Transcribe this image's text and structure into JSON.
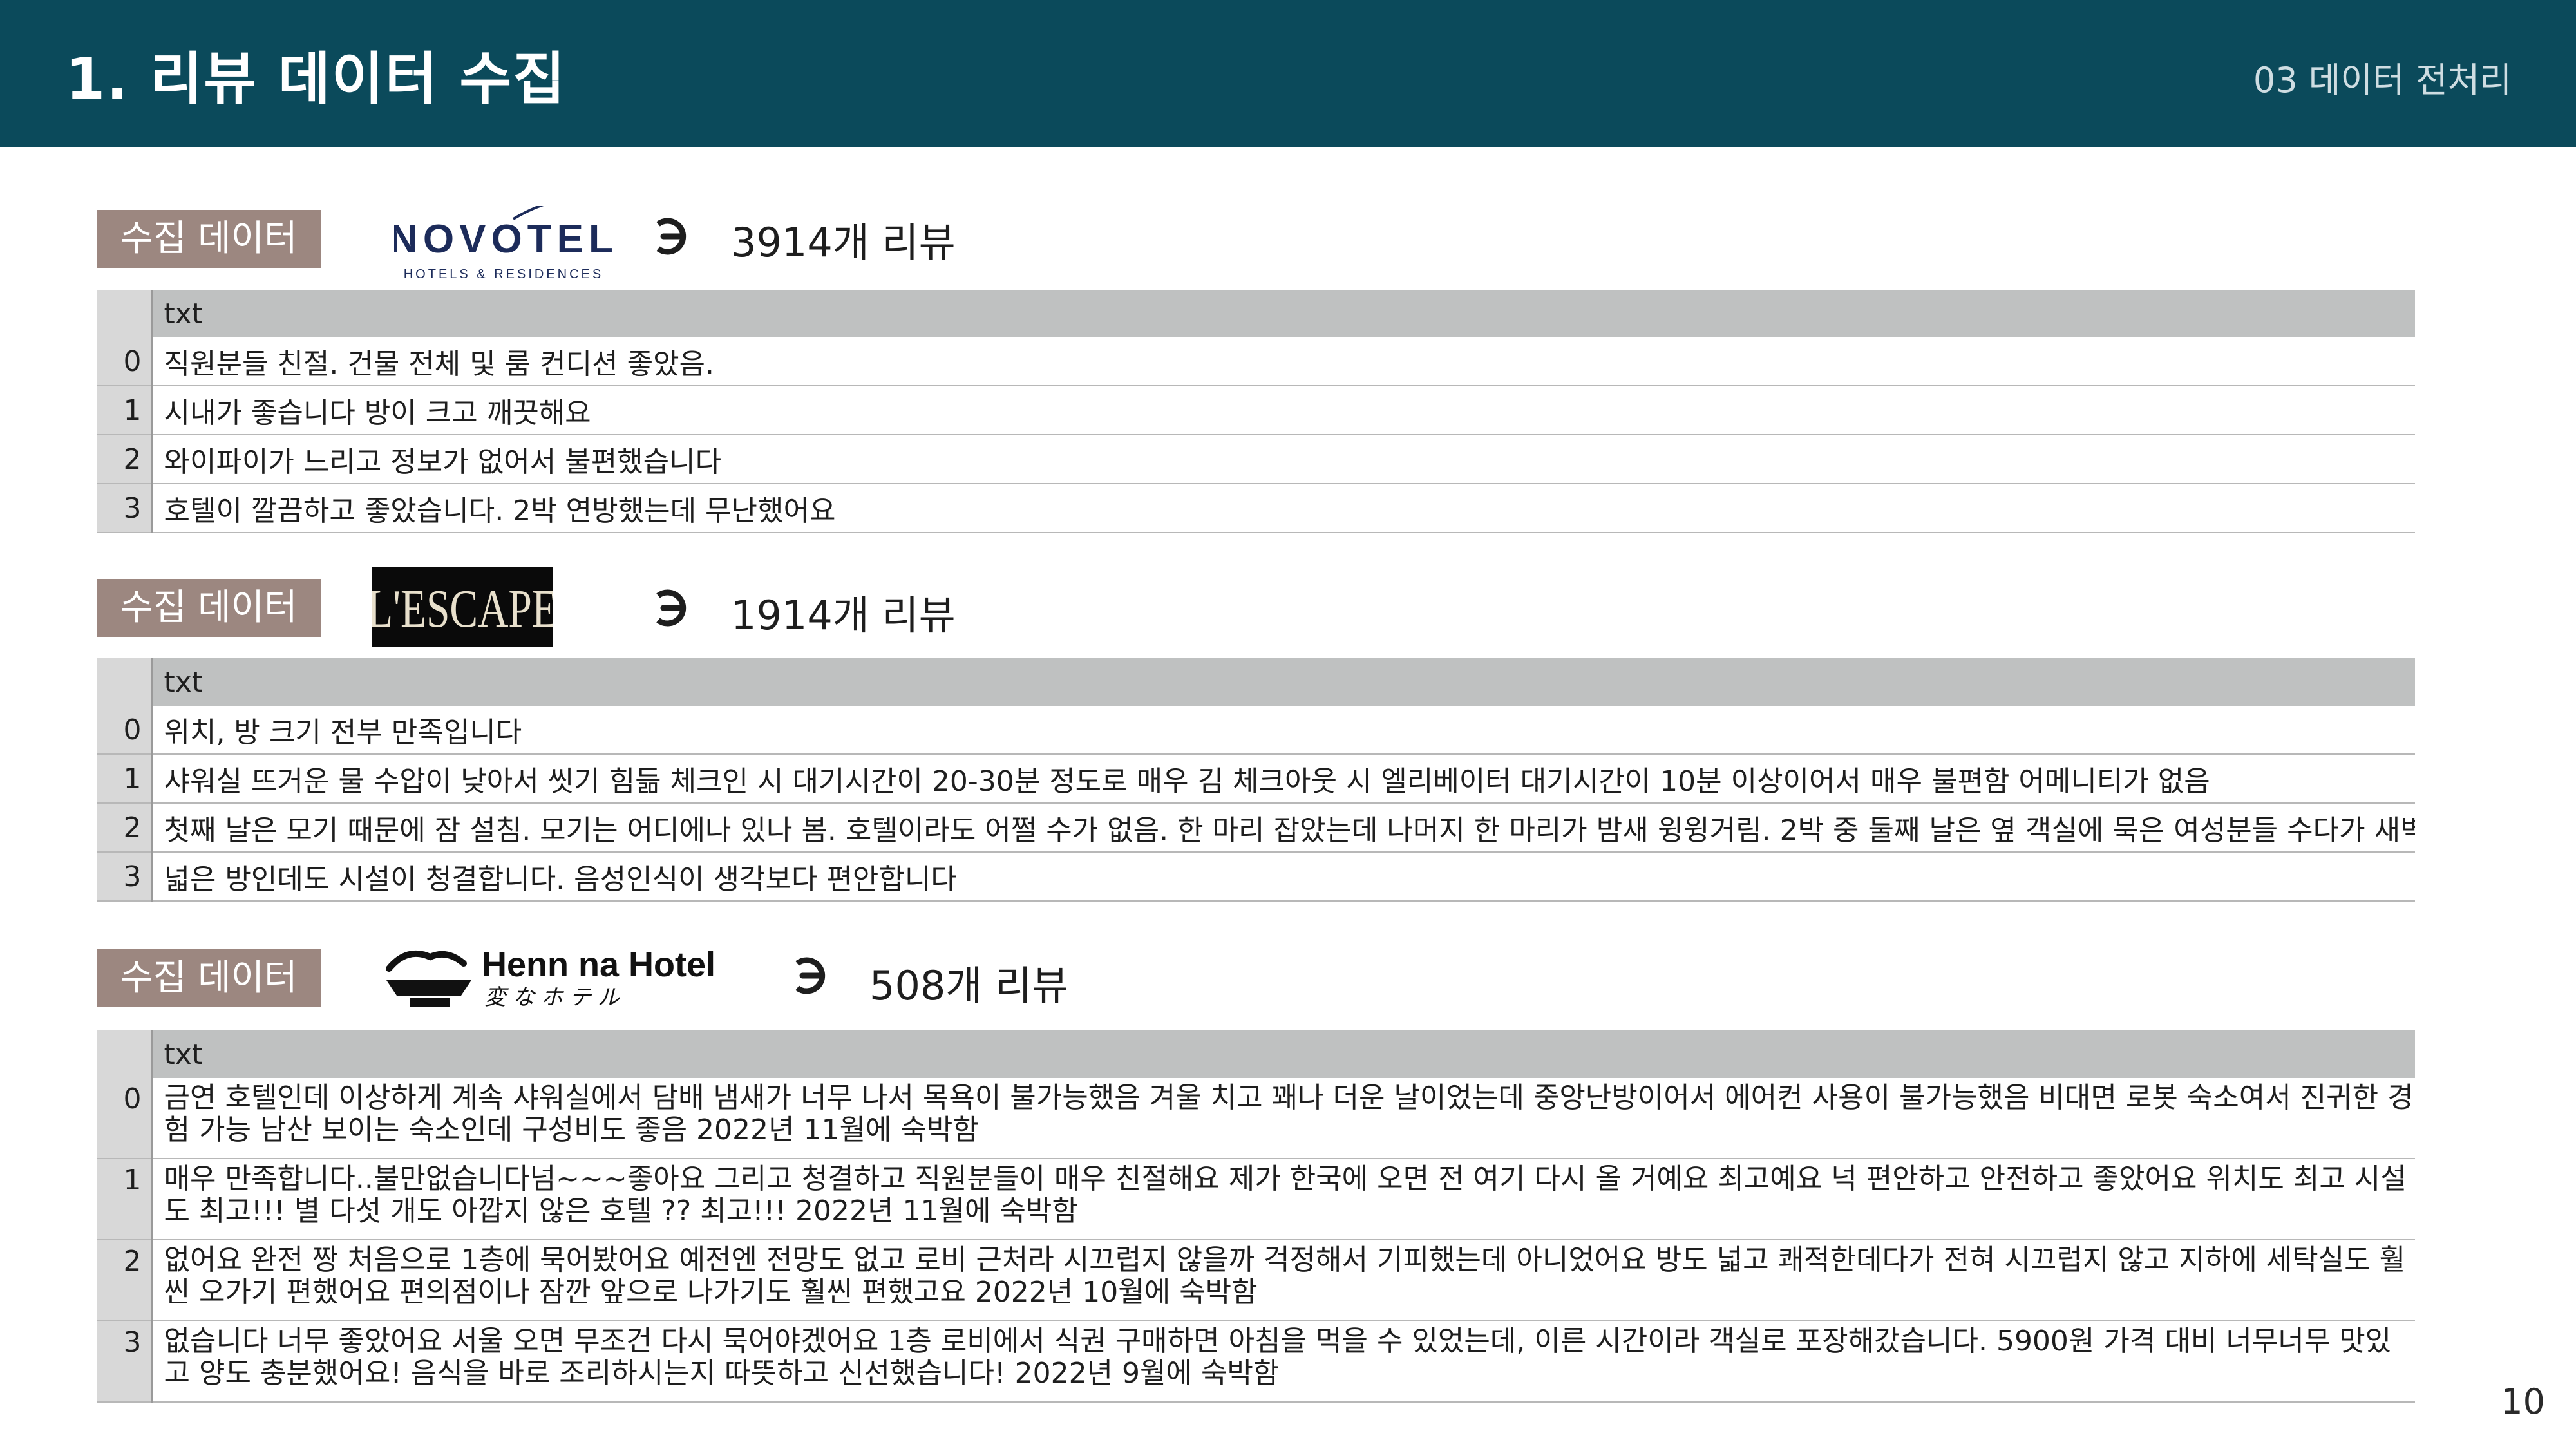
{
  "header": {
    "title": "1. 리뷰 데이터 수집",
    "section": "03 데이터 전처리"
  },
  "page_number": "10",
  "colors": {
    "header_bg": "#0b4a5b",
    "badge_bg": "#9c8780",
    "table_header_bg": "#bfc1c1"
  },
  "blocks": [
    {
      "badge": "수집 데이터",
      "logo": {
        "name": "NOVOTEL",
        "sub": "HOTELS & RESIDENCES"
      },
      "count": "3914개 리뷰",
      "table": {
        "column": "txt",
        "rows": [
          {
            "index": "0",
            "text": "직원분들 친절. 건물 전체 및 룸 컨디션 좋았음."
          },
          {
            "index": "1",
            "text": "시내가 좋습니다 방이 크고 깨끗해요"
          },
          {
            "index": "2",
            "text": "와이파이가 느리고 정보가 없어서 불편했습니다"
          },
          {
            "index": "3",
            "text": "호텔이 깔끔하고 좋았습니다. 2박 연방했는데 무난했어요"
          }
        ]
      }
    },
    {
      "badge": "수집 데이터",
      "logo": {
        "name": "L'ESCAPE"
      },
      "count": "1914개 리뷰",
      "table": {
        "column": "txt",
        "rows": [
          {
            "index": "0",
            "text": "위치, 방 크기 전부 만족입니다"
          },
          {
            "index": "1",
            "text": "샤워실 뜨거운 물 수압이 낮아서 씻기 힘듦 체크인 시 대기시간이 20-30분 정도로 매우 김 체크아웃 시 엘리베이터 대기시간이 10분 이상이어서 매우 불편함 어메니티가 없음"
          },
          {
            "index": "2",
            "text": "첫째 날은 모기 때문에 잠 설침. 모기는 어디에나 있나 봄. 호텔이라도 어쩔 수가 없음. 한 마리 잡았는데 나머지 한 마리가 밤새 윙윙거림. 2박 중 둘째 날은 옆 객실에 묵은 여성분들 수다가 새벽까지 들"
          },
          {
            "index": "3",
            "text": "넓은 방인데도 시설이 청결합니다. 음성인식이 생각보다 편안합니다"
          }
        ]
      }
    },
    {
      "badge": "수집 데이터",
      "logo": {
        "name": "Henn na Hotel",
        "sub": "変なホテル"
      },
      "count": "508개 리뷰",
      "table": {
        "column": "txt",
        "rows": [
          {
            "index": "0",
            "text": "금연 호텔인데 이상하게 계속 샤워실에서 담배 냄새가 너무 나서 목욕이 불가능했음 겨울 치고 꽤나 더운 날이었는데 중앙난방이어서 에어컨 사용이 불가능했음 비대면 로봇 숙소여서 진귀한 경험 가능 남산 보이는 숙소인데 구성비도 좋음 2022년 11월에 숙박함"
          },
          {
            "index": "1",
            "text": "매우 만족합니다..불만없습니다넘~~~좋아요 그리고 청결하고 직원분들이 매우 친절해요 제가 한국에 오면 전 여기 다시 올 거예요 최고예요 넉 편안하고 안전하고 좋았어요 위치도 최고 시설도 최고!!! 별 다섯 개도 아깝지 않은 호텔 ?? 최고!!! 2022년 11월에 숙박함"
          },
          {
            "index": "2",
            "text": "없어요 완전 짱 처음으로 1층에 묵어봤어요 예전엔 전망도 없고 로비 근처라 시끄럽지 않을까 걱정해서 기피했는데 아니었어요 방도 넓고 쾌적한데다가 전혀 시끄럽지 않고 지하에 세탁실도 훨씬 오가기 편했어요 편의점이나 잠깐 앞으로 나가기도 훨씬 편했고요 2022년 10월에 숙박함"
          },
          {
            "index": "3",
            "text": "없습니다 너무 좋았어요 서울 오면 무조건 다시 묵어야겠어요 1층 로비에서 식권 구매하면 아침을 먹을 수 있었는데, 이른 시간이라 객실로 포장해갔습니다. 5900원 가격 대비 너무너무 맛있고 양도 충분했어요! 음식을 바로 조리하시는지 따뜻하고 신선했습니다! 2022년 9월에 숙박함"
          }
        ]
      }
    }
  ]
}
